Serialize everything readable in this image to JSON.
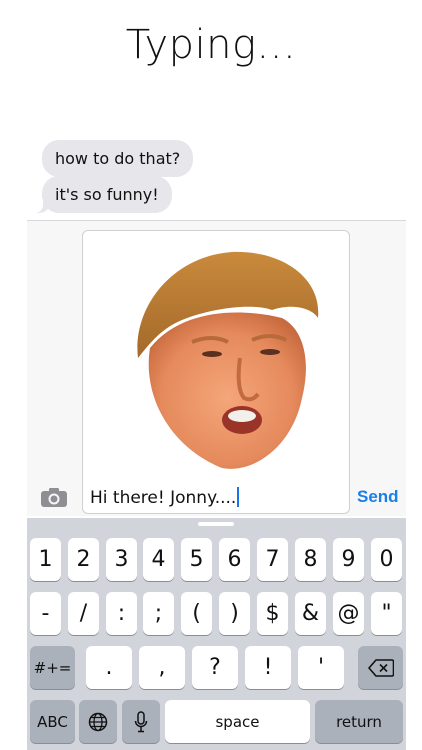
{
  "header": {
    "title": "Typing..."
  },
  "conversation": {
    "messages": [
      {
        "text": "how to do that?"
      },
      {
        "text": "it's so funny!"
      }
    ]
  },
  "composer": {
    "text": "Hi there! Jonny....",
    "send_label": "Send",
    "icons": {
      "camera": "camera-icon"
    }
  },
  "keyboard": {
    "row1": [
      "1",
      "2",
      "3",
      "4",
      "5",
      "6",
      "7",
      "8",
      "9",
      "0"
    ],
    "row2": [
      "-",
      "/",
      ":",
      ";",
      "(",
      ")",
      "$",
      "&",
      "@",
      "\""
    ],
    "row3": {
      "symbols": "#+=",
      "keys": [
        ".",
        ",",
        "?",
        "!",
        "'"
      ],
      "delete_icon": "delete-icon"
    },
    "row4": {
      "abc": "ABC",
      "globe_icon": "globe-icon",
      "mic_icon": "microphone-icon",
      "space": "space",
      "return": "return"
    }
  },
  "colors": {
    "accent": "#1a7fe6",
    "bubble": "#e6e6eb",
    "keyboard_bg": "#d1d5db",
    "special_key": "#abb1ba"
  }
}
